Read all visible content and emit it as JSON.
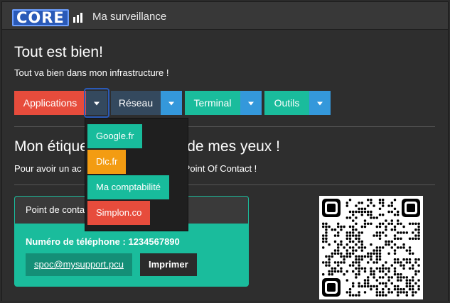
{
  "header": {
    "logo_text": "CORE",
    "title": "Ma surveillance"
  },
  "status": {
    "title": "Tout est bien!",
    "text": "Tout va bien dans mon infrastructure !"
  },
  "buttons": {
    "applications": "Applications",
    "reseau": "Réseau",
    "terminal": "Terminal",
    "outils": "Outils"
  },
  "dropdown": {
    "items": [
      "Google.fr",
      "Dlc.fr",
      "Ma comptabilité",
      "Simplon.co"
    ]
  },
  "label_section": {
    "title_left": "Mon étique",
    "title_right": "s de mes yeux !",
    "text_left": "Pour avoir un ac",
    "text_right": "Point Of Contact !"
  },
  "poc": {
    "header": "Point de conta",
    "phone": "Numéro de téléphone : 1234567890",
    "email": "spoc@mysupport.pcu",
    "print": "Imprimer"
  },
  "colors": {
    "red": "#e74c3c",
    "teal": "#1abc9c",
    "blue": "#3498db",
    "dark_blue": "#34495e",
    "orange": "#f39c12"
  }
}
